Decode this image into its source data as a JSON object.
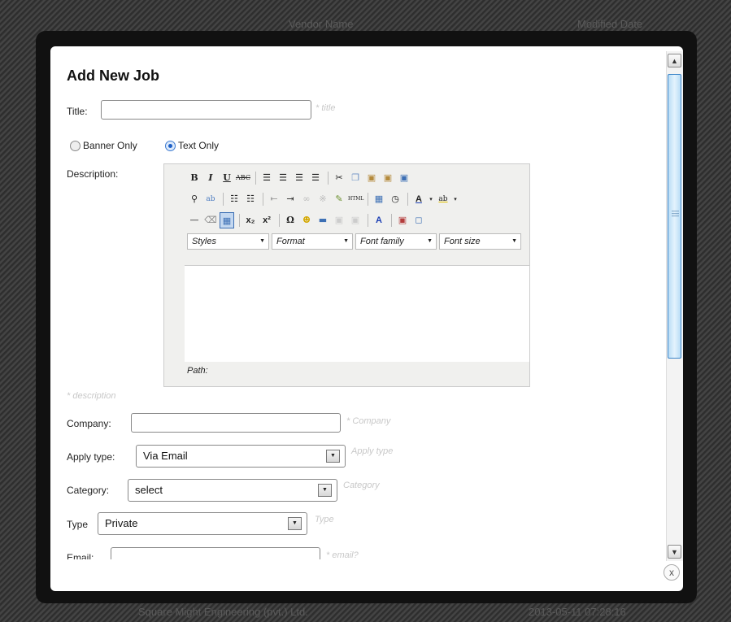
{
  "background": {
    "top_col1": "Vendor Name",
    "top_col2": "Modified Date",
    "bottom_row_name": "Square Might Engineering (pvt.) Ltd.",
    "bottom_row_date": "2013-05-11 07:28:16"
  },
  "modal": {
    "title": "Add New Job",
    "close_label": "x",
    "title_field": {
      "label": "Title:",
      "value": "",
      "hint": "* title"
    },
    "banner_type": {
      "options": [
        {
          "label": "Banner Only",
          "checked": false
        },
        {
          "label": "Text Only",
          "checked": true
        }
      ]
    },
    "description": {
      "label": "Description:",
      "hint": "* description",
      "path_label": "Path:",
      "dropdowns": [
        "Styles",
        "Format",
        "Font family",
        "Font size"
      ],
      "toolbar_row1": [
        "bold-icon",
        "italic-icon",
        "underline-icon",
        "strikethrough-icon",
        "|",
        "align-left-icon",
        "align-center-icon",
        "align-right-icon",
        "align-justify-icon",
        "|",
        "cut-icon",
        "copy-icon",
        "paste-icon",
        "paste-text-icon",
        "paste-word-icon"
      ],
      "toolbar_row2": [
        "find-icon",
        "replace-icon",
        "|",
        "bullet-list-icon",
        "numbered-list-icon",
        "|",
        "outdent-icon",
        "indent-icon",
        "link-icon",
        "unlink-icon",
        "cleanup-icon",
        "html-icon",
        "|",
        "insert-date-icon",
        "insert-time-icon",
        "|",
        "text-color-icon",
        "background-color-icon"
      ],
      "toolbar_row3": [
        "horizontal-rule-icon",
        "remove-format-icon",
        "table-icon",
        "|",
        "subscript-icon",
        "superscript-icon",
        "|",
        "special-char-icon",
        "emoticon-icon",
        "hr-line-icon",
        "block-icon",
        "layer-icon",
        "|",
        "style-icon",
        "|",
        "image-icon",
        "media-icon"
      ]
    },
    "company": {
      "label": "Company:",
      "value": "",
      "hint": "* Company"
    },
    "apply_type": {
      "label": "Apply type:",
      "value": "Via Email",
      "hint": "Apply type"
    },
    "category": {
      "label": "Category:",
      "value": "select",
      "hint": "Category"
    },
    "type": {
      "label": "Type",
      "value": "Private",
      "hint": "Type"
    },
    "email": {
      "label": "Email:",
      "value": "",
      "hint": "* email?"
    }
  },
  "colors": {
    "accent": "#3c85c8",
    "hint": "#c8c8c8"
  }
}
